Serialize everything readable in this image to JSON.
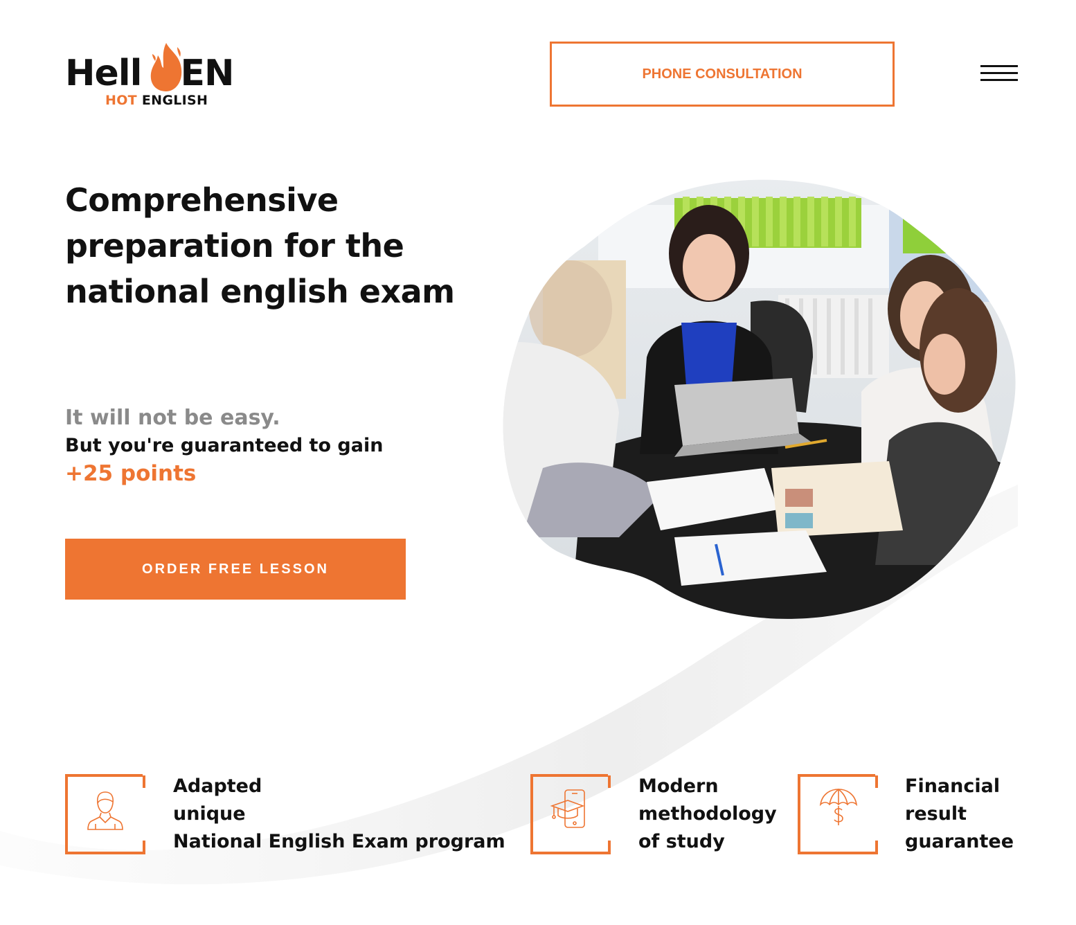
{
  "header": {
    "logo": {
      "main_left": "Hell",
      "main_right": "EN",
      "sub_hot": "HOT",
      "sub_english": "ENGLISH"
    },
    "phone_button_label": "PHONE CONSULTATION",
    "menu_icon": "hamburger-menu-icon"
  },
  "hero": {
    "headline": "Comprehensive preparation for the national english exam",
    "tagline_grey": "It will not be easy.",
    "tagline_black": "But you're guaranteed to gain",
    "tagline_orange": "+25 points",
    "cta_label": "ORDER FREE LESSON",
    "image_icon": "classroom-photo"
  },
  "features": [
    {
      "icon": "student-icon",
      "lines": [
        "Adapted",
        "unique",
        "National English Exam program"
      ]
    },
    {
      "icon": "mobile-graduation-cap-icon",
      "lines": [
        "Modern",
        "methodology",
        "of study"
      ]
    },
    {
      "icon": "umbrella-dollar-icon",
      "lines": [
        "Financial",
        "result",
        "guarantee"
      ]
    }
  ],
  "colors": {
    "accent": "#ee7532",
    "text": "#111111",
    "muted": "#8a8a8a",
    "background": "#ffffff"
  }
}
